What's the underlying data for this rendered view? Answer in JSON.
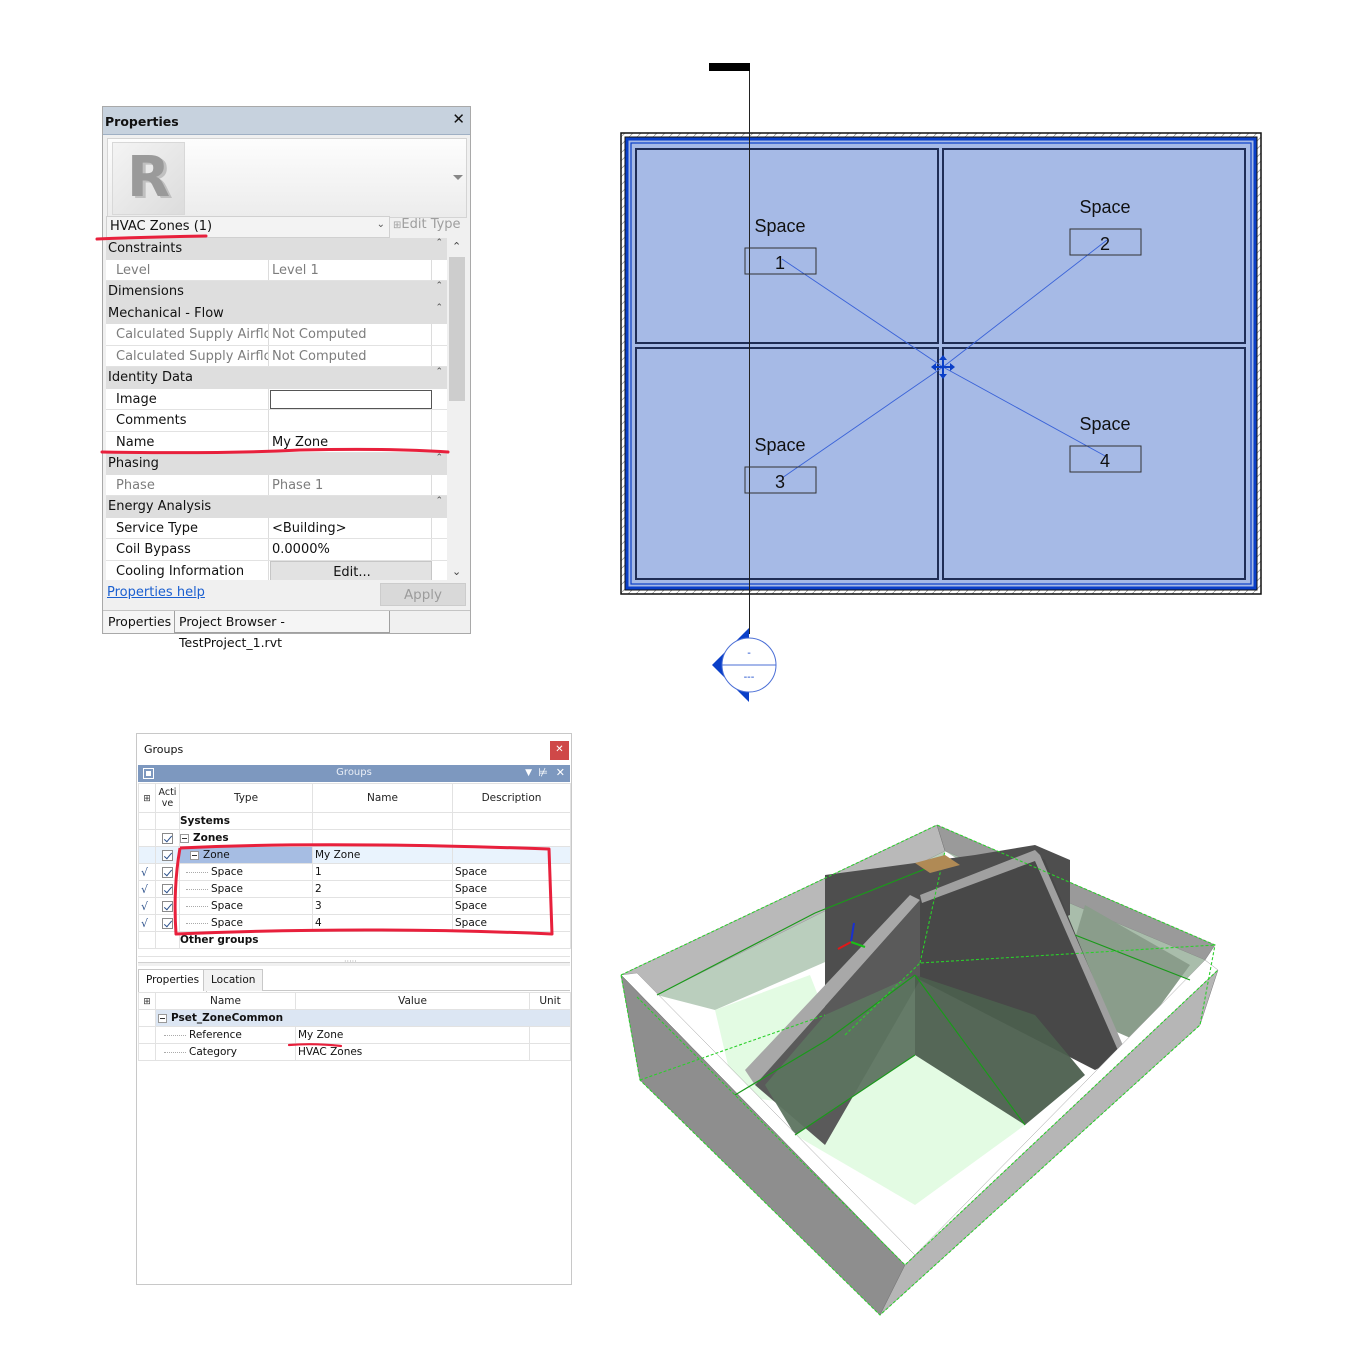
{
  "revit_properties": {
    "title": "Properties",
    "close_icon": "close-icon",
    "logo_letter": "R",
    "type_selector": "HVAC Zones (1)",
    "edit_type_label": "Edit Type",
    "categories": [
      {
        "label": "Constraints",
        "rows": [
          {
            "key": "Level",
            "value": "Level 1",
            "readonly": true
          }
        ]
      },
      {
        "label": "Dimensions",
        "rows": []
      },
      {
        "label": "Mechanical - Flow",
        "rows": [
          {
            "key": "Calculated Supply Airflo...",
            "value": "Not Computed",
            "readonly": true
          },
          {
            "key": "Calculated Supply Airflo...",
            "value": "Not Computed",
            "readonly": true
          }
        ]
      },
      {
        "label": "Identity Data",
        "rows": [
          {
            "key": "Image",
            "value": ""
          },
          {
            "key": "Comments",
            "value": ""
          },
          {
            "key": "Name",
            "value": "My Zone"
          }
        ]
      },
      {
        "label": "Phasing",
        "rows": [
          {
            "key": "Phase",
            "value": "Phase 1",
            "readonly": true
          }
        ]
      },
      {
        "label": "Energy Analysis",
        "rows": [
          {
            "key": "Service Type",
            "value": "<Building>"
          },
          {
            "key": "Coil Bypass",
            "value": "0.0000%"
          },
          {
            "key": "Cooling Information",
            "value": "Edit..."
          }
        ]
      }
    ],
    "help_link": "Properties help",
    "apply_button": "Apply",
    "tabs": [
      "Properties",
      "Project Browser - TestProject_1.rvt"
    ]
  },
  "floor_plan": {
    "spaces": [
      {
        "label": "Space",
        "number": "1"
      },
      {
        "label": "Space",
        "number": "2"
      },
      {
        "label": "Space",
        "number": "3"
      },
      {
        "label": "Space",
        "number": "4"
      }
    ],
    "section_tag": {
      "top": "-",
      "bottom": "---"
    },
    "colors": {
      "zone_fill": "#a6bae6",
      "zone_border": "#0a3fc8",
      "wall": "#1f2d55",
      "link_line": "#3a63d8"
    }
  },
  "groups_window": {
    "title": "Groups",
    "panel_title": "Groups",
    "columns": [
      "Active",
      "Type",
      "Name",
      "Description"
    ],
    "tree": [
      {
        "type": "Systems",
        "name": "",
        "description": "",
        "level": 0,
        "bold": true,
        "active": false,
        "tick": false
      },
      {
        "type": "Zones",
        "name": "",
        "description": "",
        "level": 1,
        "bold": true,
        "active": true,
        "tick": false
      },
      {
        "type": "Zone",
        "name": "My Zone",
        "description": "",
        "level": 2,
        "bold": false,
        "active": true,
        "tick": false
      },
      {
        "type": "Space",
        "name": "1",
        "description": "Space",
        "level": 3,
        "bold": false,
        "active": true,
        "tick": true
      },
      {
        "type": "Space",
        "name": "2",
        "description": "Space",
        "level": 3,
        "bold": false,
        "active": true,
        "tick": true
      },
      {
        "type": "Space",
        "name": "3",
        "description": "Space",
        "level": 3,
        "bold": false,
        "active": true,
        "tick": true
      },
      {
        "type": "Space",
        "name": "4",
        "description": "Space",
        "level": 3,
        "bold": false,
        "active": true,
        "tick": true
      },
      {
        "type": "Other groups",
        "name": "",
        "description": "",
        "level": 0,
        "bold": true,
        "active": false,
        "tick": false
      }
    ],
    "prop_tabs": [
      "Properties",
      "Location"
    ],
    "prop_columns": [
      "Name",
      "Value",
      "Unit"
    ],
    "pset": "Pset_ZoneCommon",
    "props": [
      {
        "name": "Reference",
        "value": "My Zone",
        "unit": ""
      },
      {
        "name": "Category",
        "value": "HVAC Zones",
        "unit": ""
      }
    ],
    "colors": {
      "panel_header": "#7d98bf",
      "close_button": "#cf4848",
      "selection": "#a6bde3"
    }
  },
  "view_3d": {
    "colors": {
      "wall": "#8e8e8e",
      "wall_top": "#ffffff",
      "partition": "#4a4a4a",
      "space_fill": "#e3fbe3",
      "space_edge": "#22aa22"
    }
  },
  "annotation_color": "#e8203c"
}
